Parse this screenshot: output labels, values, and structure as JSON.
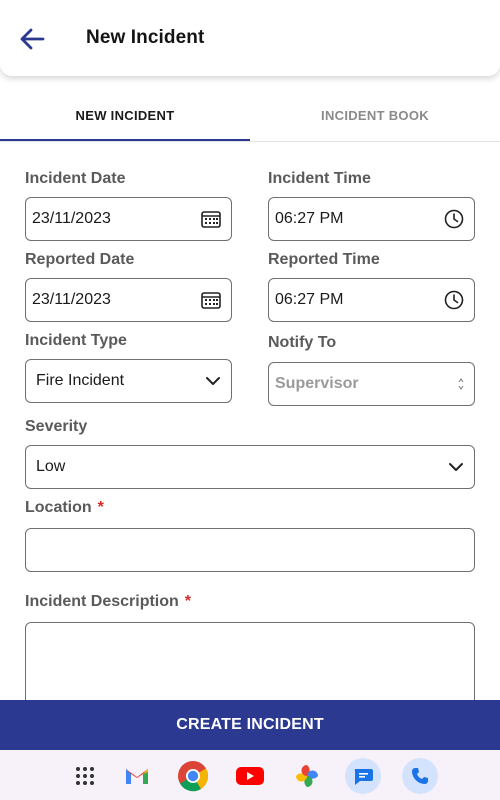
{
  "header": {
    "title": "New Incident"
  },
  "tabs": [
    {
      "label": "NEW INCIDENT",
      "active": true
    },
    {
      "label": "INCIDENT BOOK",
      "active": false
    }
  ],
  "form": {
    "incident_date": {
      "label": "Incident Date",
      "value": "23/11/2023"
    },
    "incident_time": {
      "label": "Incident Time",
      "value": "06:27 PM"
    },
    "reported_date": {
      "label": "Reported Date",
      "value": "23/11/2023"
    },
    "reported_time": {
      "label": "Reported Time",
      "value": "06:27 PM"
    },
    "incident_type": {
      "label": "Incident Type",
      "value": "Fire Incident"
    },
    "notify_to": {
      "label": "Notify To",
      "placeholder": "Supervisor"
    },
    "severity": {
      "label": "Severity",
      "value": "Low"
    },
    "location": {
      "label": "Location",
      "required_mark": "*",
      "value": ""
    },
    "description": {
      "label": "Incident Description",
      "required_mark": "*",
      "value": ""
    }
  },
  "submit": {
    "label": "CREATE INCIDENT"
  },
  "dock": {
    "apps": [
      "app-drawer-icon",
      "gmail-icon",
      "chrome-icon",
      "youtube-icon",
      "photos-icon",
      "messages-icon",
      "phone-icon"
    ]
  },
  "colors": {
    "primary": "#2b3990",
    "required": "#d62a2a",
    "dock_bg": "#f7f2fa"
  }
}
